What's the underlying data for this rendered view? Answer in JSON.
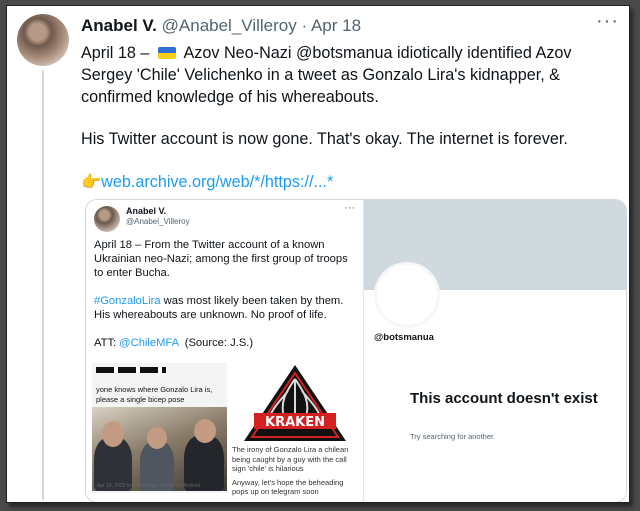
{
  "author": {
    "name": "Anabel V.",
    "handle": "@Anabel_Villeroy",
    "date": "Apr 18"
  },
  "tweet": {
    "line1_a": "April 18 – ",
    "line1_b": " Azov Neo-Nazi @botsmanua idiotically identified Azov Sergey 'Chile' Velichenko in a tweet as Gonzalo Lira's kidnapper, & confirmed knowledge of his whereabouts.",
    "para2": "His Twitter account is now gone. That's okay. The internet is forever.",
    "link_emoji": "👉",
    "link_text": "web.archive.org/web/*/https://...*"
  },
  "embedded_tweet": {
    "name": "Anabel V.",
    "handle": "@Anabel_Villeroy",
    "p1": "April 18 – From the Twitter account of a known Ukrainian neo-Nazi; among the first group of troops to enter Bucha.",
    "p2_tag": "#GonzaloLira",
    "p2_rest": " was most likely been taken by them. His whereabouts are unknown. No proof of life.",
    "p3_prefix": "ATT: ",
    "p3_mention": "@ChileMFA",
    "p3_suffix": "  (Source: J.S.)",
    "image1_caption": "yone knows where Gonzalo Lira is, please  a single bicep pose",
    "image1_footer": "· Apr 18, 2022 from Ukraine · Twitter for Android",
    "kraken_label": "KRAKEN",
    "image2_caption1": "The irony of Gonzalo Lira a chilean being caught by a guy with the call sign 'chile' is hilarious",
    "image2_caption2": "Anyway, let's hope the beheading pops up on telegram soon"
  },
  "deleted_profile": {
    "handle": "@botsmanua",
    "title": "This account doesn't exist",
    "subtitle": "Try searching for another."
  },
  "colors": {
    "link": "#1d9bf0",
    "text": "#0f1419",
    "muted": "#536471",
    "kraken_red": "#d32020"
  },
  "icons": {
    "more": "more-horizontal-icon",
    "flag": "ukraine-flag-icon"
  }
}
